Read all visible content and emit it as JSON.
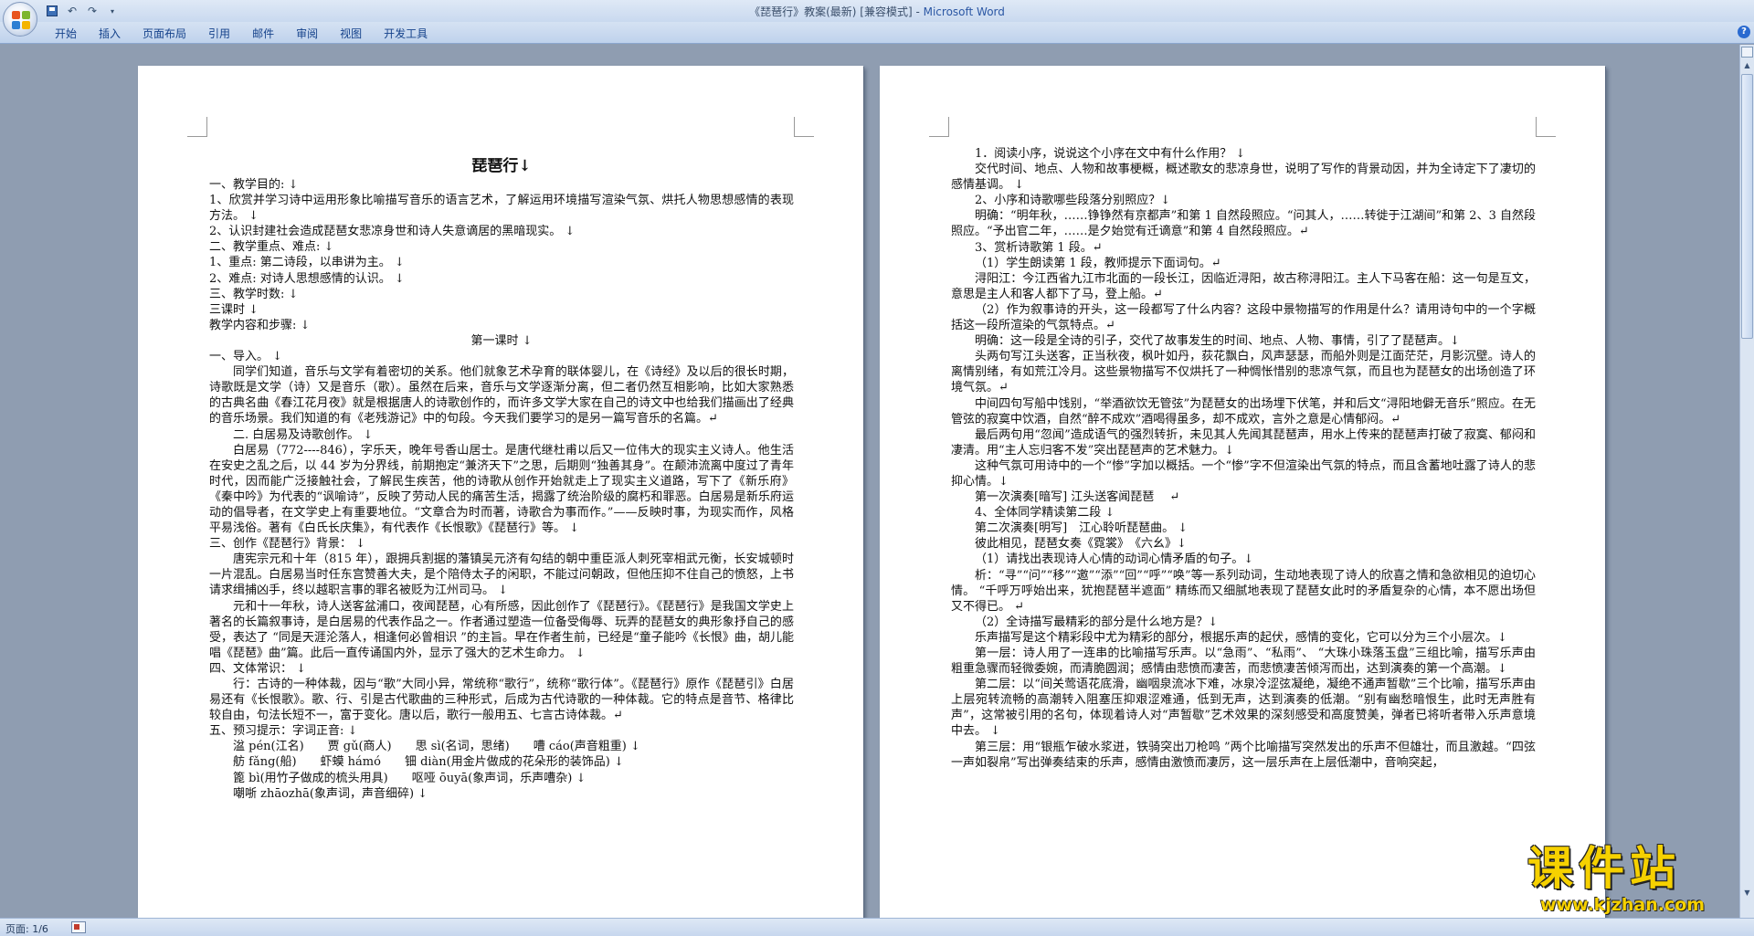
{
  "window": {
    "title": "《琵琶行》教案(最新) [兼容模式] - ",
    "app_name": "Microsoft Word"
  },
  "quick_access": {
    "icons": [
      "save-icon",
      "undo-icon",
      "redo-icon",
      "customize-icon"
    ]
  },
  "ribbon": {
    "tabs": [
      {
        "label": "开始"
      },
      {
        "label": "插入"
      },
      {
        "label": "页面布局"
      },
      {
        "label": "引用"
      },
      {
        "label": "邮件"
      },
      {
        "label": "审阅"
      },
      {
        "label": "视图"
      },
      {
        "label": "开发工具"
      }
    ]
  },
  "status": {
    "page_count": "页面: 1/6"
  },
  "watermark": {
    "title": "课件站",
    "url": "www.kjzhan.com"
  },
  "page1": {
    "doc_title": "琵琶行↓",
    "paragraphs": [
      {
        "s": "",
        "t": "一、教学目的: ↓"
      },
      {
        "s": "",
        "t": "1、欣赏并学习诗中运用形象比喻描写音乐的语言艺术，了解运用环境描写渲染气氛、烘托人物思想感情的表现方法。 ↓"
      },
      {
        "s": "",
        "t": "2、认识封建社会造成琵琶女悲凉身世和诗人失意谪居的黑暗现实。 ↓"
      },
      {
        "s": "",
        "t": "二、教学重点、难点: ↓"
      },
      {
        "s": "",
        "t": "1、重点: 第二诗段，以串讲为主。 ↓"
      },
      {
        "s": "",
        "t": "2、难点: 对诗人思想感情的认识。 ↓"
      },
      {
        "s": "",
        "t": "三、教学时数: ↓"
      },
      {
        "s": "",
        "t": "三课时 ↓"
      },
      {
        "s": "",
        "t": "教学内容和步骤: ↓"
      },
      {
        "s": "center",
        "t": "第一课时 ↓"
      },
      {
        "s": "",
        "t": "一、导入。 ↓"
      },
      {
        "s": "ind",
        "t": "同学们知道，音乐与文学有着密切的关系。他们就象艺术孕育的联体婴儿，在《诗经》及以后的很长时期，诗歌既是文学（诗）又是音乐（歌）。虽然在后来，音乐与文学逐渐分离，但二者仍然互相影响，比如大家熟悉的古典名曲《春江花月夜》就是根据唐人的诗歌创作的，而许多文学大家在自己的诗文中也给我们描画出了经典的音乐场景。我们知道的有《老残游记》中的句段。今天我们要学习的是另一篇写音乐的名篇。↵"
      },
      {
        "s": "ind",
        "t": "二. 白居易及诗歌创作。 ↓"
      },
      {
        "s": "ind",
        "t": "白居易（772----846），字乐天，晚年号香山居士。是唐代继杜甫以后又一位伟大的现实主义诗人。他生活在安史之乱之后，以 44 岁为分界线，前期抱定“兼济天下”之思，后期则“独善其身”。在颠沛流离中度过了青年时代，因而能广泛接触社会，了解民生疾苦，他的诗歌从创作开始就走上了现实主义道路，写下了《新乐府》《秦中吟》为代表的“讽喻诗”，反映了劳动人民的痛苦生活，揭露了统治阶级的腐朽和罪恶。白居易是新乐府运动的倡导者，在文学史上有重要地位。“文章合为时而著，诗歌合为事而作。”——反映时事，为现实而作，风格平易浅俗。著有《白氏长庆集》，有代表作《长恨歌》《琵琶行》等。 ↓"
      },
      {
        "s": "",
        "t": "三、创作《琵琶行》背景： ↓"
      },
      {
        "s": "ind",
        "t": "唐宪宗元和十年（815 年），跟拥兵割据的藩镇吴元济有勾结的朝中重臣派人刺死宰相武元衡，长安城顿时一片混乱。白居易当时任东宫赞善大夫，是个陪侍太子的闲职，不能过问朝政，但他压抑不住自己的愤怒，上书请求缉捕凶手，终以越职言事的罪名被贬为江州司马。 ↓"
      },
      {
        "s": "ind",
        "t": "元和十一年秋，诗人送客盆浦口，夜闻琵琶，心有所感，因此创作了《琵琶行》。《琵琶行》是我国文学史上著名的长篇叙事诗，是白居易的代表作品之一。作者通过塑造一位备受侮辱、玩弄的琵琶女的典形象抒自己的感受，表达了 “同是天涯沦落人，相逢何必曾相识 ”的主旨。早在作者生前，已经是“童子能吟《长恨》曲，胡儿能唱《琵琶》曲”篇。此后一直传诵国内外，显示了强大的艺术生命力。 ↓"
      },
      {
        "s": "",
        "t": "四、文体常识： ↓"
      },
      {
        "s": "ind",
        "t": "行：古诗的一种体裁，因与“歌”大同小异，常统称“歌行”，统称“歌行体”。《琵琶行》原作《琵琶引》白居易还有《长恨歌》。歌、行、引是古代歌曲的三种形式，后成为古代诗歌的一种体裁。它的特点是音节、格律比较自由，句法长短不一，富于变化。唐以后，歌行一般用五、七言古诗体裁。↵"
      },
      {
        "s": "",
        "t": "五、预习提示：字词正音: ↓"
      },
      {
        "s": "ind2",
        "t": "湓 pén(江名)　　贾 gǔ(商人)　　思 sì(名词，思绪)　　嘈 cáo(声音粗重) ↓"
      },
      {
        "s": "ind2",
        "t": "舫 fǎng(船)　　虾蟆 hámó　　钿 diàn(用金片做成的花朵形的装饰品) ↓"
      },
      {
        "s": "ind2",
        "t": "篦 bì(用竹子做成的梳头用具)　　呕哑 ōuyā(象声词，乐声嘈杂) ↓"
      },
      {
        "s": "ind2",
        "t": "嘲哳 zhāozhā(象声词，声音细碎) ↓"
      }
    ]
  },
  "page2": {
    "paragraphs": [
      {
        "s": "ind",
        "t": "1．阅读小序，说说这个小序在文中有什么作用？ ↓"
      },
      {
        "s": "ind",
        "t": "交代时间、地点、人物和故事梗概，概述歌女的悲凉身世，说明了写作的背景动因，并为全诗定下了凄切的感情基调。 ↓"
      },
      {
        "s": "ind",
        "t": "2、小序和诗歌哪些段落分别照应？↓"
      },
      {
        "s": "ind",
        "t": "明确：“明年秋，……铮铮然有京都声”和第 1 自然段照应。“问其人，……转徙于江湖间”和第 2、3 自然段照应。“予出官二年，……是夕始觉有迁谪意”和第 4 自然段照应。↵"
      },
      {
        "s": "ind",
        "t": "3、赏析诗歌第 1 段。↵"
      },
      {
        "s": "ind",
        "t": "（1）学生朗读第 1 段，教师提示下面词句。↵"
      },
      {
        "s": "ind",
        "t": "浔阳江：今江西省九江市北面的一段长江，因临近浔阳，故古称浔阳江。主人下马客在船：这一句是互文，意思是主人和客人都下了马，登上船。↵"
      },
      {
        "s": "ind",
        "t": "（2）作为叙事诗的开头，这一段都写了什么内容？这段中景物描写的作用是什么？请用诗句中的一个字概括这一段所渲染的气氛特点。↵"
      },
      {
        "s": "ind",
        "t": "明确：这一段是全诗的引子，交代了故事发生的时间、地点、人物、事情，引了了琵琶声。↓"
      },
      {
        "s": "ind",
        "t": "头两句写江头送客，正当秋夜，枫叶如丹，荻花飘白，风声瑟瑟，而船外则是江面茫茫，月影沉壁。诗人的离情别绪，有如荒江冷月。这些景物描写不仅烘托了一种惆怅惜别的悲凉气氛，而且也为琵琶女的出场创造了环境气氛。↵"
      },
      {
        "s": "ind",
        "t": "中间四句写船中饯别，“举酒欲饮无管弦”为琵琶女的出场埋下伏笔，并和后文“浔阳地僻无音乐”照应。在无管弦的寂寞中饮酒，自然“醉不成欢”酒喝得虽多，却不成欢，言外之意是心情郁闷。↵"
      },
      {
        "s": "ind",
        "t": "最后两句用“忽闻”造成语气的强烈转折，未见其人先闻其琵琶声，用水上传来的琵琶声打破了寂寞、郁闷和凄清。用“主人忘归客不发”突出琵琶声的艺术魅力。↓"
      },
      {
        "s": "ind",
        "t": "这种气氛可用诗中的一个“惨”字加以概括。一个“惨”字不但渲染出气氛的特点，而且含蓄地吐露了诗人的悲抑心情。↓"
      },
      {
        "s": "ind",
        "t": "第一次演奏[暗写] 江头送客闻琵琶　 ↵"
      },
      {
        "s": "ind",
        "t": "4、全体同学精读第二段 ↓"
      },
      {
        "s": "ind",
        "t": "第二次演奏[明写]　江心聆听琵琶曲。 ↓"
      },
      {
        "s": "ind",
        "t": "彼此相见，琵琶女奏《霓裳》　《六幺》↓"
      },
      {
        "s": "ind",
        "t": "（1）请找出表现诗人心情的动词心情矛盾的句子。↓"
      },
      {
        "s": "ind",
        "t": "析：“寻”“问”“移”“邀”“添”“回”“呼”“唤”等一系列动词，生动地表现了诗人的欣喜之情和急欲相见的迫切心情。 “千呼万呼始出来，犹抱琵琶半遮面” 精练而又细腻地表现了琵琶女此时的矛盾复杂的心情，本不愿出场但又不得已。 ↵"
      },
      {
        "s": "ind",
        "t": "（2）全诗描写最精彩的部分是什么地方是？↓"
      },
      {
        "s": "ind",
        "t": "乐声描写是这个精彩段中尤为精彩的部分，根据乐声的起伏，感情的变化，它可以分为三个小层次。↓"
      },
      {
        "s": "ind",
        "t": "第一层：诗人用了一连串的比喻描写乐声。以“急雨”、“私雨”、 “大珠小珠落玉盘”三组比喻，描写乐声由粗重急骤而轻微委婉，而清脆圆润；感情由悲愤而凄苦，而悲愤凄苦倾泻而出，达到演奏的第一个高潮。↓"
      },
      {
        "s": "ind",
        "t": "第二层：以“间关莺语花底滑，幽咽泉流冰下难，冰泉冷涩弦凝绝，凝绝不通声暂歇”三个比喻，描写乐声由上层宛转流畅的高潮转入阻塞压抑艰涩难通，低到无声，达到演奏的低潮。“别有幽愁暗恨生，此时无声胜有声”，这常被引用的名句，体现着诗人对“声暂歇”艺术效果的深刻感受和高度赞美，弹者已将听者带入乐声意境中去。 ↓"
      },
      {
        "s": "ind",
        "t": "第三层：用“银瓶乍破水浆迸，铁骑突出刀枪鸣 ”两个比喻描写突然发出的乐声不但雄壮，而且激越。“四弦一声如裂帛”写出弹奏结束的乐声，感情由激愤而凄厉，这一层乐声在上层低潮中，音响突起，"
      }
    ]
  }
}
